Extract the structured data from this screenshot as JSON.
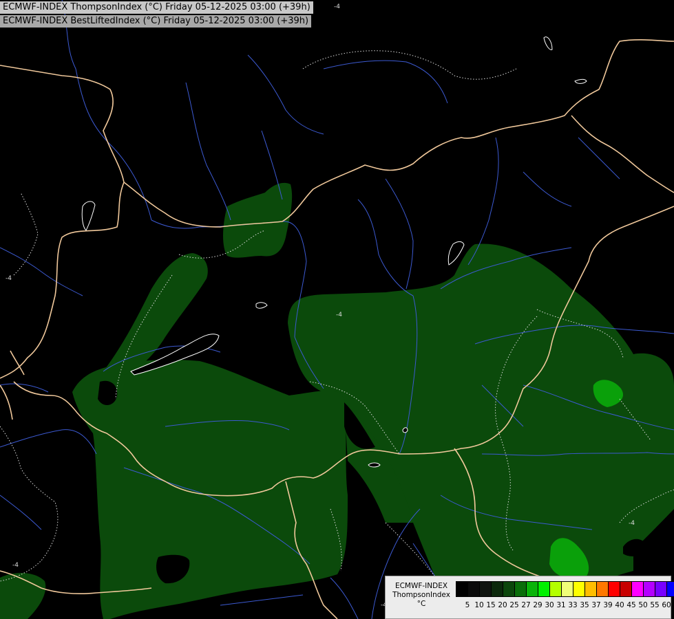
{
  "header": {
    "title_line1": "ECMWF-INDEX ThompsonIndex (°C) Friday 05-12-2025 03:00 (+39h)",
    "title_line2": "ECMWF-INDEX BestLiftedIndex (°C) Friday 05-12-2025 03:00 (+39h)"
  },
  "map_labels": {
    "contour_label": "-4"
  },
  "legend": {
    "title_line1": "ECMWF-INDEX",
    "title_line2": "ThompsonIndex",
    "unit": "°C",
    "colors": [
      "#000000",
      "#0a0a0a",
      "#0f140f",
      "#0b280b",
      "#0c460c",
      "#0a6e0a",
      "#0ab40a",
      "#00f000",
      "#b4ff00",
      "#f0ff78",
      "#ffff00",
      "#ffbe00",
      "#ff7800",
      "#ff0000",
      "#c80000",
      "#ff00ff",
      "#b400ff",
      "#7800ff",
      "#0000ff"
    ],
    "ticks": [
      "5",
      "10",
      "15",
      "20",
      "25",
      "27",
      "29",
      "30",
      "31",
      "33",
      "35",
      "37",
      "39",
      "40",
      "45",
      "50",
      "55",
      "60"
    ]
  },
  "colors": {
    "border": "#f0c89b",
    "river": "#3c5ad2",
    "field_low": "#0b4a0b",
    "field_mid": "#0aa00a",
    "contour": "#dcdcdc"
  }
}
